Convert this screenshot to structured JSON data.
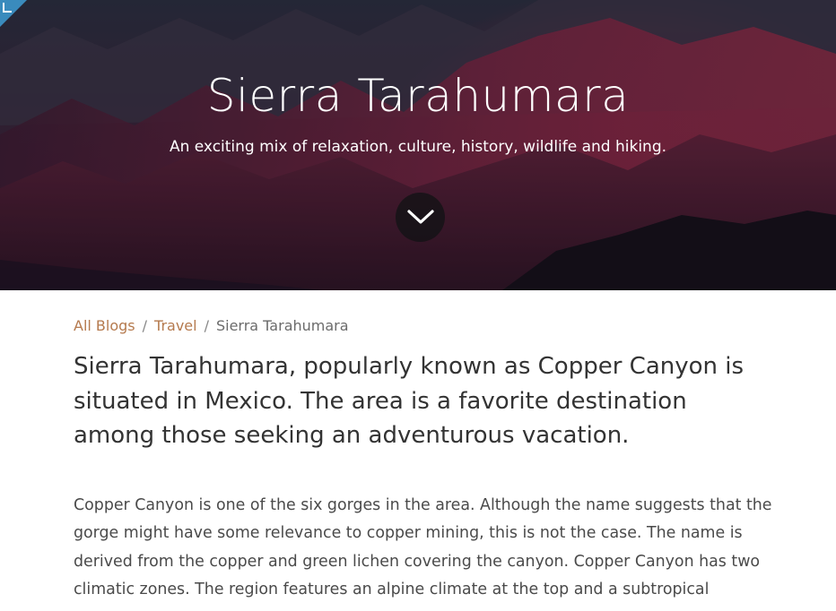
{
  "hero": {
    "title": "Sierra Tarahumara",
    "subtitle": "An exciting mix of relaxation, culture, history, wildlife and hiking.",
    "scroll_icon": "chevron-down-icon",
    "corner_icon": "corner-bracket-icon"
  },
  "breadcrumb": {
    "items": [
      {
        "label": "All Blogs"
      },
      {
        "label": "Travel"
      },
      {
        "label": "Sierra Tarahumara"
      }
    ],
    "separator": "/"
  },
  "article": {
    "lead": "Sierra Tarahumara, popularly known as Copper Canyon is situated in Mexico. The area is a favorite destination among those seeking an adventurous vacation.",
    "paragraph": "Copper Canyon is one of the six gorges in the area. Although the name suggests that the gorge might have some relevance to copper mining, this is not the case. The name is derived from the copper and green lichen covering the canyon. Copper Canyon has two climatic zones. The region features an alpine climate at the top and a subtropical"
  },
  "colors": {
    "link": "#b57a4e",
    "badge": "#3a8bbd"
  }
}
